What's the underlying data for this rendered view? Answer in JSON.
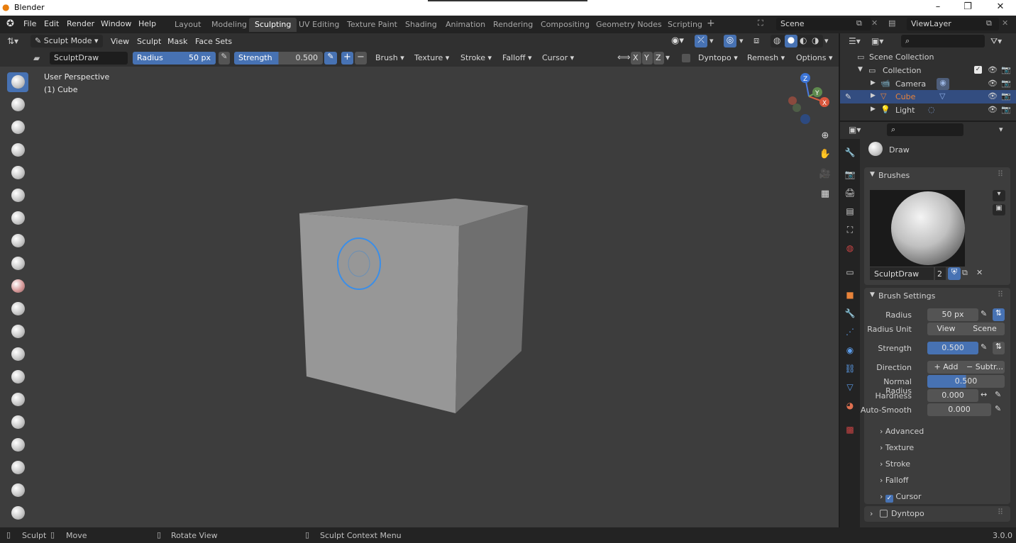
{
  "window": {
    "title": "Blender"
  },
  "menu": [
    "File",
    "Edit",
    "Render",
    "Window",
    "Help"
  ],
  "workspaces": [
    "Layout",
    "Modeling",
    "Sculpting",
    "UV Editing",
    "Texture Paint",
    "Shading",
    "Animation",
    "Rendering",
    "Compositing",
    "Geometry Nodes",
    "Scripting"
  ],
  "active_workspace": "Sculpting",
  "scene": {
    "label": "Scene",
    "view_layer": "ViewLayer"
  },
  "header": {
    "mode": "Sculpt Mode",
    "menus": [
      "View",
      "Sculpt",
      "Mask",
      "Face Sets"
    ]
  },
  "toolbar": {
    "brush_name": "SculptDraw",
    "radius_label": "Radius",
    "radius_value": "50 px",
    "strength_label": "Strength",
    "strength_value": "0.500",
    "dropdowns": [
      "Brush",
      "Texture",
      "Stroke",
      "Falloff",
      "Cursor"
    ],
    "axes": [
      "X",
      "Y",
      "Z"
    ],
    "dyntopo": "Dyntopo",
    "remesh": "Remesh",
    "options": "Options"
  },
  "viewport": {
    "perspective": "User Perspective",
    "object": "(1) Cube"
  },
  "outliner": {
    "root": "Scene Collection",
    "collection": "Collection",
    "items": [
      "Camera",
      "Cube",
      "Light"
    ],
    "selected": "Cube"
  },
  "properties": {
    "tool_name": "Draw",
    "brushes_header": "Brushes",
    "brush_name": "SculptDraw",
    "brush_users": "2",
    "settings_header": "Brush Settings",
    "radius_label": "Radius",
    "radius_value": "50 px",
    "radius_unit_label": "Radius Unit",
    "radius_unit_view": "View",
    "radius_unit_scene": "Scene",
    "strength_label": "Strength",
    "strength_value": "0.500",
    "direction_label": "Direction",
    "direction_add": "Add",
    "direction_subtract": "Subtr...",
    "normal_radius_label": "Normal Radius",
    "normal_radius_value": "0.500",
    "hardness_label": "Hardness",
    "hardness_value": "0.000",
    "autosmooth_label": "Auto-Smooth",
    "autosmooth_value": "0.000",
    "subpanels": [
      "Advanced",
      "Texture",
      "Stroke",
      "Falloff",
      "Cursor"
    ],
    "dyntopo_label": "Dyntopo"
  },
  "status": {
    "sculpt": "Sculpt",
    "move": "Move",
    "rotate": "Rotate View",
    "context": "Sculpt Context Menu",
    "version": "3.0.0"
  },
  "colors": {
    "accent": "#4772b3",
    "selected_row": "#334d80",
    "object_orange": "#e8833a"
  }
}
